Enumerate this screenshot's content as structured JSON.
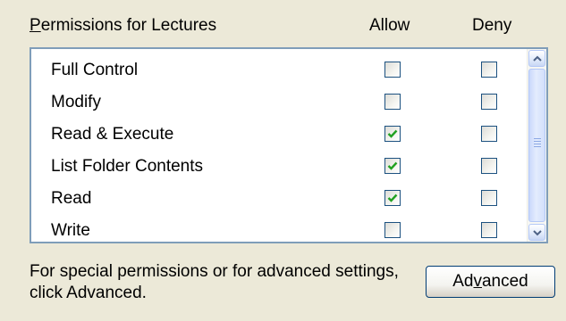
{
  "header": {
    "title_mnemonic": "P",
    "title_rest": "ermissions for Lectures",
    "allow_label": "Allow",
    "deny_label": "Deny"
  },
  "permissions": [
    {
      "label": "Full Control",
      "allow": false,
      "deny": false
    },
    {
      "label": "Modify",
      "allow": false,
      "deny": false
    },
    {
      "label": "Read & Execute",
      "allow": true,
      "deny": false
    },
    {
      "label": "List Folder Contents",
      "allow": true,
      "deny": false
    },
    {
      "label": "Read",
      "allow": true,
      "deny": false
    },
    {
      "label": "Write",
      "allow": false,
      "deny": false
    }
  ],
  "footer": {
    "line1": "For special permissions or for advanced settings,",
    "line2": "click Advanced."
  },
  "advanced_button": {
    "before": "Ad",
    "mnemonic": "v",
    "after": "anced"
  },
  "colors": {
    "dialog_bg": "#ECE9D8",
    "list_border": "#7F9DB9",
    "checkbox_border": "#1C5180",
    "check_mark": "#21A121",
    "button_border": "#003C74"
  },
  "icons": {
    "scroll_up": "chevron-up-icon",
    "scroll_down": "chevron-down-icon",
    "check": "check-mark-icon",
    "thumb_grip": "scroll-grip-icon"
  }
}
